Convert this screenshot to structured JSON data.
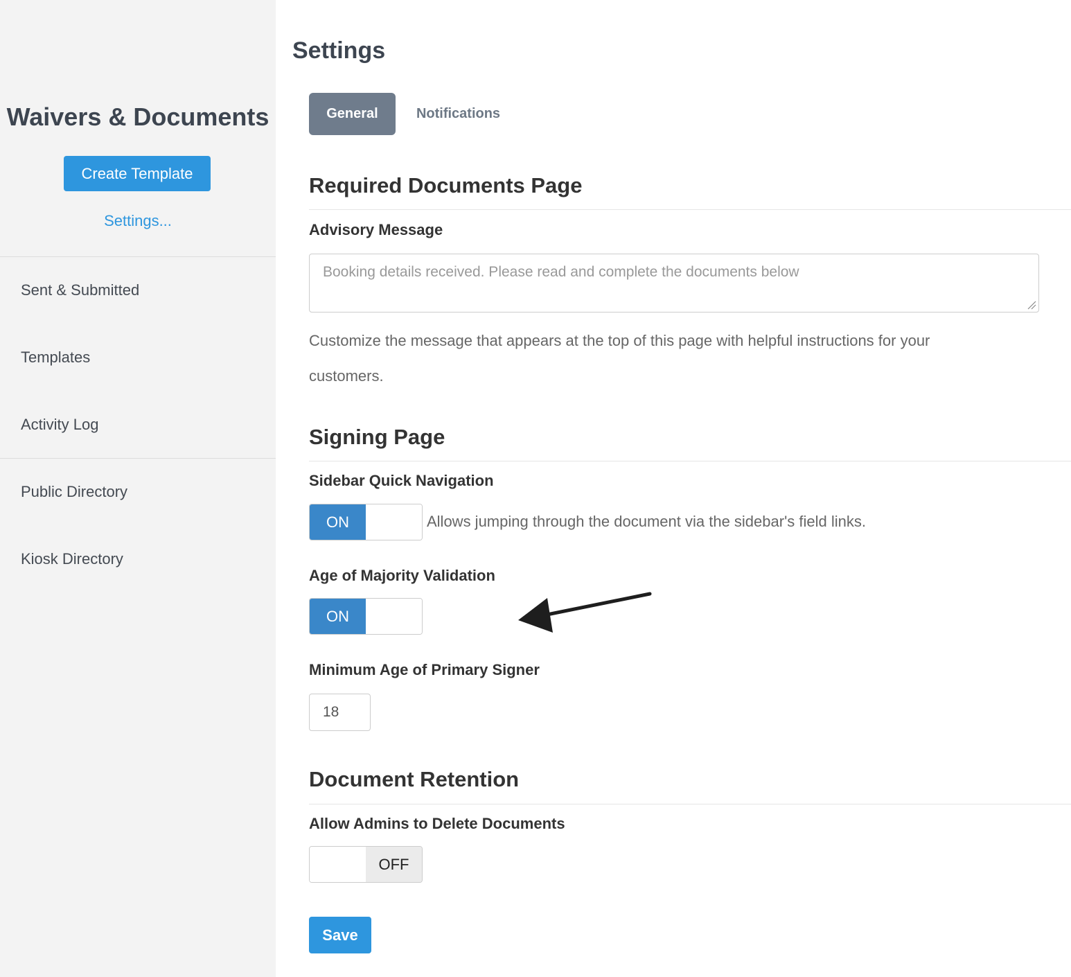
{
  "sidebar": {
    "title": "Waivers & Documents",
    "create_button": "Create Template",
    "settings_link": "Settings...",
    "items": [
      {
        "label": "Sent & Submitted"
      },
      {
        "label": "Templates"
      },
      {
        "label": "Activity Log"
      },
      {
        "label": "Public Directory"
      },
      {
        "label": "Kiosk Directory"
      }
    ]
  },
  "main": {
    "title": "Settings",
    "tabs": [
      {
        "label": "General",
        "active": true
      },
      {
        "label": "Notifications",
        "active": false
      }
    ],
    "required_documents": {
      "title": "Required Documents Page",
      "advisory_label": "Advisory Message",
      "advisory_value": "",
      "advisory_placeholder": "Booking details received. Please read and complete the documents below",
      "help_text": "Customize the message that appears at the top of this page with helpful instructions for your customers."
    },
    "signing_page": {
      "title": "Signing Page",
      "sidebar_nav_label": "Sidebar Quick Navigation",
      "sidebar_nav_state": "ON",
      "sidebar_nav_desc": "Allows jumping through the document via the sidebar's field links.",
      "majority_label": "Age of Majority Validation",
      "majority_state": "ON",
      "min_age_label": "Minimum Age of Primary Signer",
      "min_age_value": "18"
    },
    "document_retention": {
      "title": "Document Retention",
      "allow_delete_label": "Allow Admins to Delete Documents",
      "allow_delete_state": "OFF"
    },
    "save_button": "Save"
  },
  "colors": {
    "accent": "#2e96de",
    "toggle_on": "#3a87c9",
    "tab_active": "#6f7c8c",
    "sidebar_bg": "#f3f3f3"
  },
  "icons": {
    "textarea_resize": "resize-handle-icon",
    "annotation": "arrow-pointer-icon"
  }
}
